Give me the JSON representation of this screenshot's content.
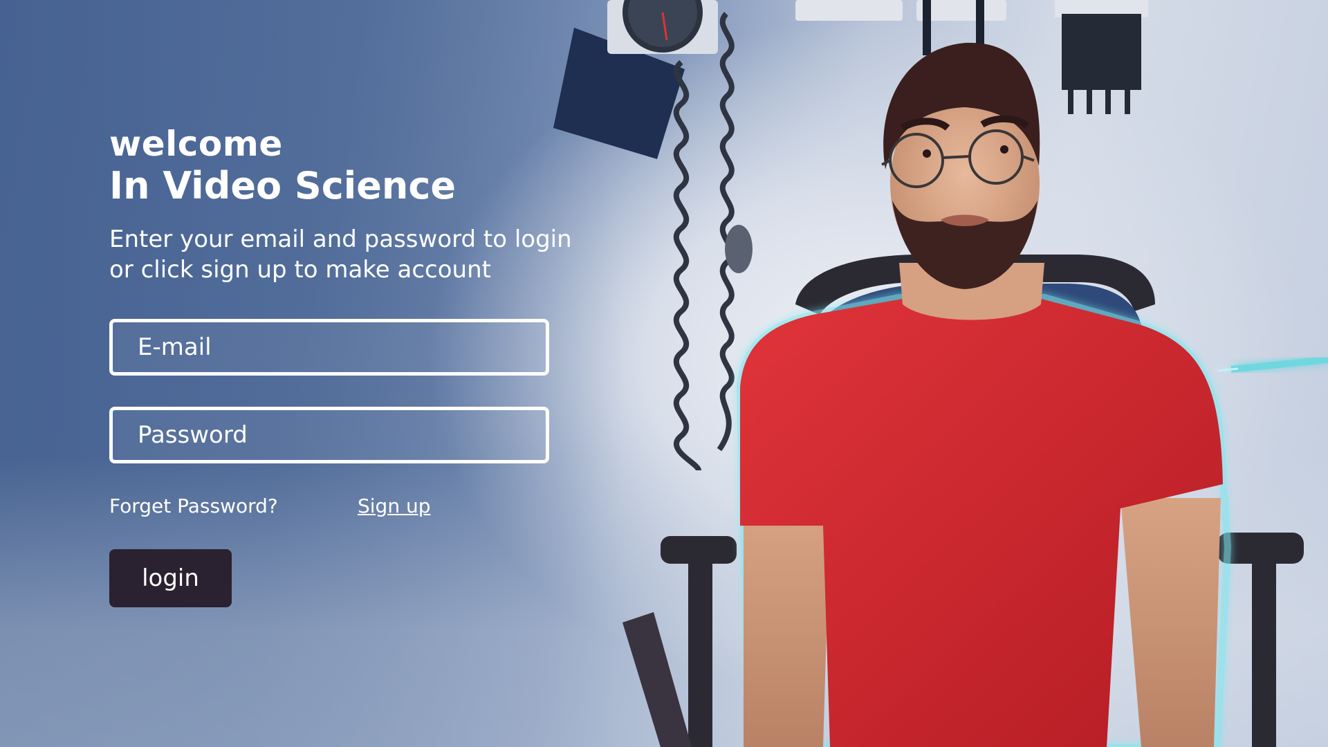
{
  "hero": {
    "welcome": "welcome",
    "brand": "In Video Science",
    "subtitle": "Enter your email and password to login or click sign up to make account"
  },
  "form": {
    "email_placeholder": "E-mail",
    "email_value": "",
    "password_placeholder": "Password",
    "password_value": "",
    "forget_label": "Forget Password?",
    "signup_label": "Sign up",
    "login_label": "login"
  },
  "colors": {
    "panel_text": "#ffffff",
    "login_button": "#2a2230",
    "shirt": "#d9282e",
    "glow": "#7fe8f0"
  },
  "icons": {
    "background_scene": "doctor-office-photo"
  }
}
